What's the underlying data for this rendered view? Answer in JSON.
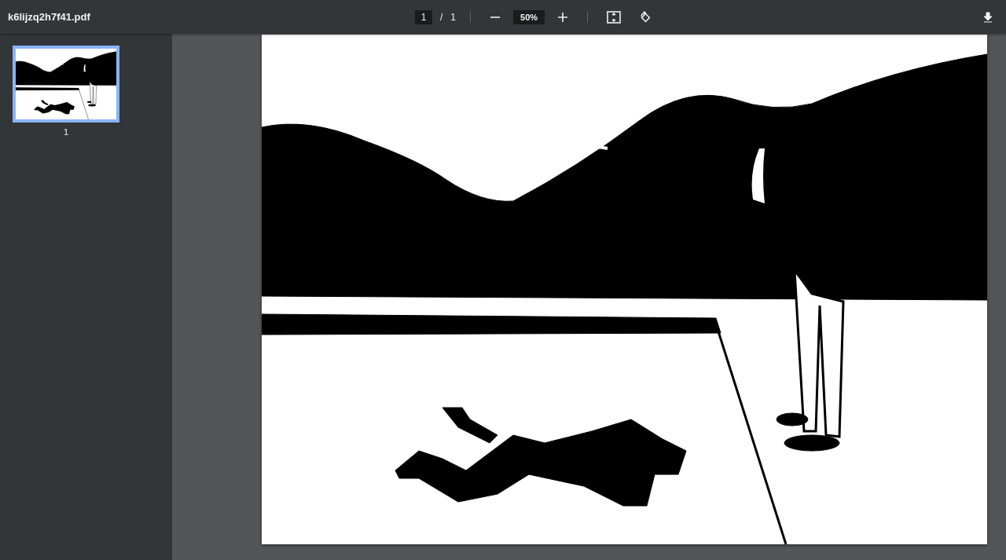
{
  "toolbar": {
    "file_name": "k6lijzq2h7f41.pdf",
    "page_input": "1",
    "page_separator": "/",
    "page_total": "1",
    "zoom_value": "50%"
  },
  "thumbnails": [
    {
      "label": "1",
      "selected": true
    }
  ]
}
